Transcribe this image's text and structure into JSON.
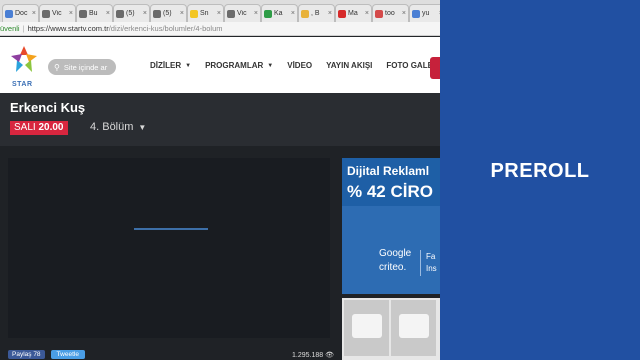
{
  "browser": {
    "tabs": [
      {
        "label": "Doc",
        "color": "#4a7fd4"
      },
      {
        "label": "Vic",
        "color": "#6b6b6b"
      },
      {
        "label": "Bu",
        "color": "#6b6b6b"
      },
      {
        "label": "(5)",
        "color": "#6b6b6b"
      },
      {
        "label": "(5)",
        "color": "#6b6b6b"
      },
      {
        "label": "Sn",
        "color": "#f3c623"
      },
      {
        "label": "Vic",
        "color": "#6b6b6b"
      },
      {
        "label": "Ka",
        "color": "#2e9c46"
      },
      {
        "label": ", B",
        "color": "#e8b23a"
      },
      {
        "label": "Ma",
        "color": "#d62a2a"
      },
      {
        "label": "too",
        "color": "#d44a4a"
      },
      {
        "label": "yu",
        "color": "#4a7fd4"
      }
    ],
    "address": {
      "security_label": "üvenli",
      "url_host": "https://www.startv.com.tr",
      "url_path": "/dizi/erkenci-kus/bolumler/4-bolum"
    }
  },
  "site": {
    "logo_text": "STAR",
    "search_placeholder": "Site içinde ar",
    "nav": [
      {
        "label": "DİZİLER",
        "has_caret": true
      },
      {
        "label": "PROGRAMLAR",
        "has_caret": true
      },
      {
        "label": "VİDEO",
        "has_caret": false
      },
      {
        "label": "YAYIN AKIŞI",
        "has_caret": false
      },
      {
        "label": "FOTO GALERİ",
        "has_caret": false
      }
    ]
  },
  "show": {
    "title": "Erkenci Kuş",
    "day": "SALI",
    "time": "20.00",
    "episode": "4. Bölüm"
  },
  "player": {
    "view_count": "1.295.188",
    "share_facebook": "Paylaş 78",
    "share_twitter": "Tweetle"
  },
  "ad": {
    "headline": "Dijital Reklaml",
    "big_text": "% 42 CİRO",
    "brand_1": "Google",
    "brand_2": "criteo.",
    "side_1": "Fa",
    "side_2": "Ins"
  },
  "overlay": {
    "label": "PREROLL",
    "panel_color": "#2150a2"
  }
}
